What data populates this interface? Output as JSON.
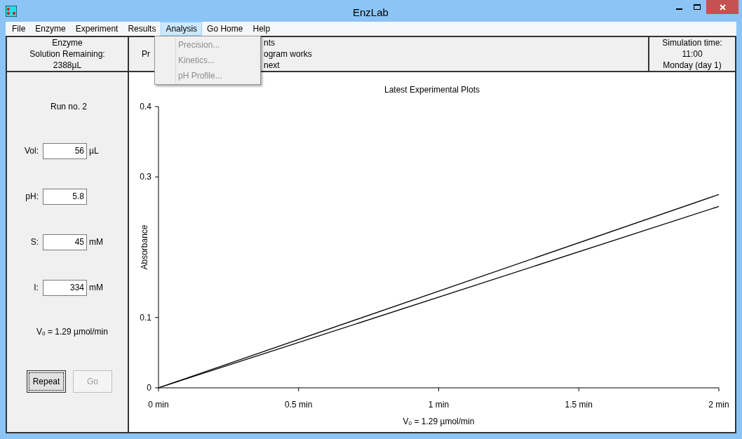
{
  "window": {
    "title": "EnzLab"
  },
  "menu": [
    {
      "label": "File",
      "selected": false
    },
    {
      "label": "Enzyme",
      "selected": false
    },
    {
      "label": "Experiment",
      "selected": false
    },
    {
      "label": "Results",
      "selected": false
    },
    {
      "label": "Analysis",
      "selected": true
    },
    {
      "label": "Go Home",
      "selected": false
    },
    {
      "label": "Help",
      "selected": false
    }
  ],
  "dropdown": [
    {
      "label": "Precision...",
      "disabled": true
    },
    {
      "label": "Kinetics...",
      "disabled": true
    },
    {
      "label": "pH Profile...",
      "disabled": true
    }
  ],
  "header": {
    "enzyme": [
      "Enzyme",
      "Solution Remaining:",
      "2388µL"
    ],
    "message_left": "Pr",
    "message_right": [
      "nts",
      "ogram works",
      "next"
    ],
    "time": [
      "Simulation time:",
      "11:00",
      "Monday (day 1)"
    ]
  },
  "run_label": "Run no. 2",
  "fields": [
    {
      "label": "Vol:",
      "value": "56",
      "unit": "µL"
    },
    {
      "label": "pH:",
      "value": "5.8"
    },
    {
      "label": "S:",
      "value": "45",
      "unit": "mM"
    },
    {
      "label": "I:",
      "value": "334",
      "unit": "mM"
    }
  ],
  "velocity": "Vₒ = 1.29 µmol/min",
  "buttons": [
    {
      "label": "Repeat",
      "disabled": false
    },
    {
      "label": "Go",
      "disabled": true
    }
  ],
  "plot": {
    "chart_data": {
      "type": "line",
      "title": "Latest Experimental Plots",
      "xlabel": "Vₒ = 1.29 µmol/min",
      "ylabel": "Absorbance",
      "x": [
        0,
        2
      ],
      "series": [
        {
          "color": "#000000",
          "values": [
            0,
            0.275
          ]
        },
        {
          "color": "#000000",
          "values": [
            0,
            0.258
          ]
        }
      ],
      "xlim": [
        0,
        2
      ],
      "ylim": [
        0,
        0.4
      ],
      "xticks": [
        {
          "value": 0,
          "label": "0 min"
        },
        {
          "value": 0.5,
          "label": "0.5 min"
        },
        {
          "value": 1,
          "label": "1 min"
        },
        {
          "value": 1.5,
          "label": "1.5 min"
        },
        {
          "value": 2,
          "label": "2 min"
        }
      ],
      "yticks": [
        {
          "value": 0,
          "label": "0"
        },
        {
          "value": 0.1,
          "label": "0.1"
        },
        {
          "value": 0.3,
          "label": "0.3"
        },
        {
          "value": 0.4,
          "label": "0.4"
        }
      ]
    }
  }
}
